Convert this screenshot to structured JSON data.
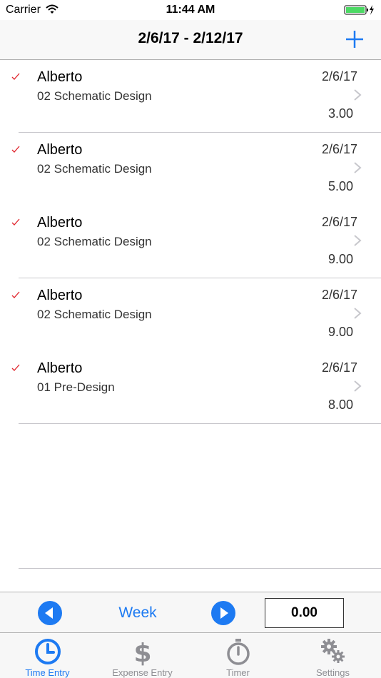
{
  "status": {
    "carrier": "Carrier",
    "time": "11:44 AM"
  },
  "nav": {
    "title": "2/6/17 - 2/12/17",
    "add_icon": "plus-icon"
  },
  "entries": [
    {
      "name": "Alberto",
      "date": "2/6/17",
      "phase": "02 Schematic Design",
      "hours": "3.00"
    },
    {
      "name": "Alberto",
      "date": "2/6/17",
      "phase": "02 Schematic Design",
      "hours": "5.00"
    },
    {
      "name": "Alberto",
      "date": "2/6/17",
      "phase": "02 Schematic Design",
      "hours": "9.00"
    },
    {
      "name": "Alberto",
      "date": "2/6/17",
      "phase": "02 Schematic Design",
      "hours": "9.00"
    },
    {
      "name": "Alberto",
      "date": "2/6/17",
      "phase": "01 Pre-Design",
      "hours": "8.00"
    }
  ],
  "week_toolbar": {
    "period": "Week",
    "total": "0.00"
  },
  "tabs": [
    {
      "label": "Time Entry",
      "icon": "clock-icon",
      "active": true
    },
    {
      "label": "Expense Entry",
      "icon": "dollar-icon",
      "active": false
    },
    {
      "label": "Timer",
      "icon": "stopwatch-icon",
      "active": false
    },
    {
      "label": "Settings",
      "icon": "gears-icon",
      "active": false
    }
  ],
  "colors": {
    "accent": "#1d7af2",
    "check": "#e0242c",
    "inactive_tab": "#8e8e93"
  }
}
